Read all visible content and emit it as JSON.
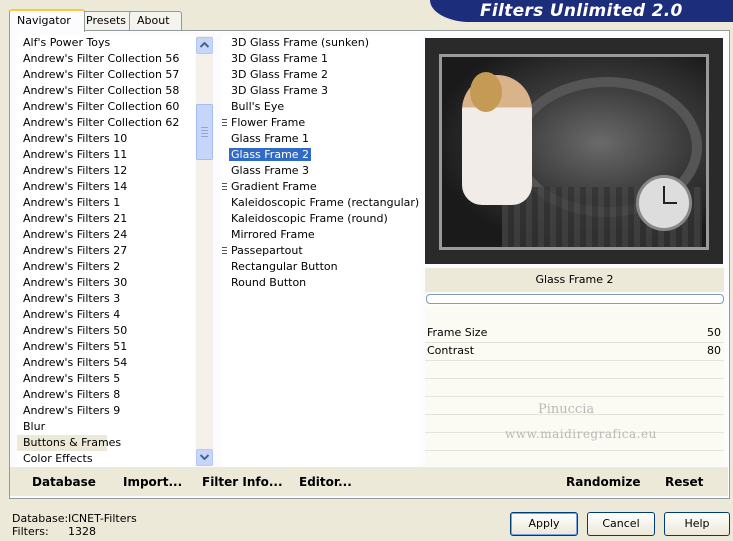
{
  "tabs": [
    "Navigator",
    "Presets",
    "About"
  ],
  "title": "Filters Unlimited 2.0",
  "categories": [
    "Alf's Power Toys",
    "Andrew's Filter Collection 56",
    "Andrew's Filter Collection 57",
    "Andrew's Filter Collection 58",
    "Andrew's Filter Collection 60",
    "Andrew's Filter Collection 62",
    "Andrew's Filters 10",
    "Andrew's Filters 11",
    "Andrew's Filters 12",
    "Andrew's Filters 14",
    "Andrew's Filters 1",
    "Andrew's Filters 21",
    "Andrew's Filters 24",
    "Andrew's Filters 27",
    "Andrew's Filters 2",
    "Andrew's Filters 30",
    "Andrew's Filters 3",
    "Andrew's Filters 4",
    "Andrew's Filters 50",
    "Andrew's Filters 51",
    "Andrew's Filters 54",
    "Andrew's Filters 5",
    "Andrew's Filters 8",
    "Andrew's Filters 9",
    "Blur",
    "Buttons & Frames",
    "Color Effects"
  ],
  "selected_category": "Buttons & Frames",
  "filters": [
    {
      "label": "3D Glass Frame (sunken)",
      "marker": false
    },
    {
      "label": "3D Glass Frame 1",
      "marker": false
    },
    {
      "label": "3D Glass Frame 2",
      "marker": false
    },
    {
      "label": "3D Glass Frame 3",
      "marker": false
    },
    {
      "label": "Bull's Eye",
      "marker": false
    },
    {
      "label": "Flower Frame",
      "marker": true
    },
    {
      "label": "Glass Frame 1",
      "marker": false
    },
    {
      "label": "Glass Frame 2",
      "marker": false
    },
    {
      "label": "Glass Frame 3",
      "marker": false
    },
    {
      "label": "Gradient Frame",
      "marker": true
    },
    {
      "label": "Kaleidoscopic Frame (rectangular)",
      "marker": false
    },
    {
      "label": "Kaleidoscopic Frame (round)",
      "marker": false
    },
    {
      "label": "Mirrored Frame",
      "marker": false
    },
    {
      "label": "Passepartout",
      "marker": true
    },
    {
      "label": "Rectangular Button",
      "marker": false
    },
    {
      "label": "Round Button",
      "marker": false
    }
  ],
  "selected_filter": "Glass Frame 2",
  "filter_name": "Glass Frame 2",
  "params": [
    {
      "label": "Frame Size",
      "value": "50"
    },
    {
      "label": "Contrast",
      "value": "80"
    }
  ],
  "watermark": {
    "line1": "Pinuccia",
    "line2": "www.maidiregrafica.eu"
  },
  "links": {
    "database": "Database",
    "import": "Import...",
    "filter_info": "Filter Info...",
    "editor": "Editor...",
    "randomize": "Randomize",
    "reset": "Reset"
  },
  "status": {
    "database_label": "Database:",
    "database_value": "ICNET-Filters",
    "filters_label": "Filters:",
    "filters_value": "1328"
  },
  "buttons": {
    "apply": "Apply",
    "cancel": "Cancel",
    "help": "Help"
  }
}
